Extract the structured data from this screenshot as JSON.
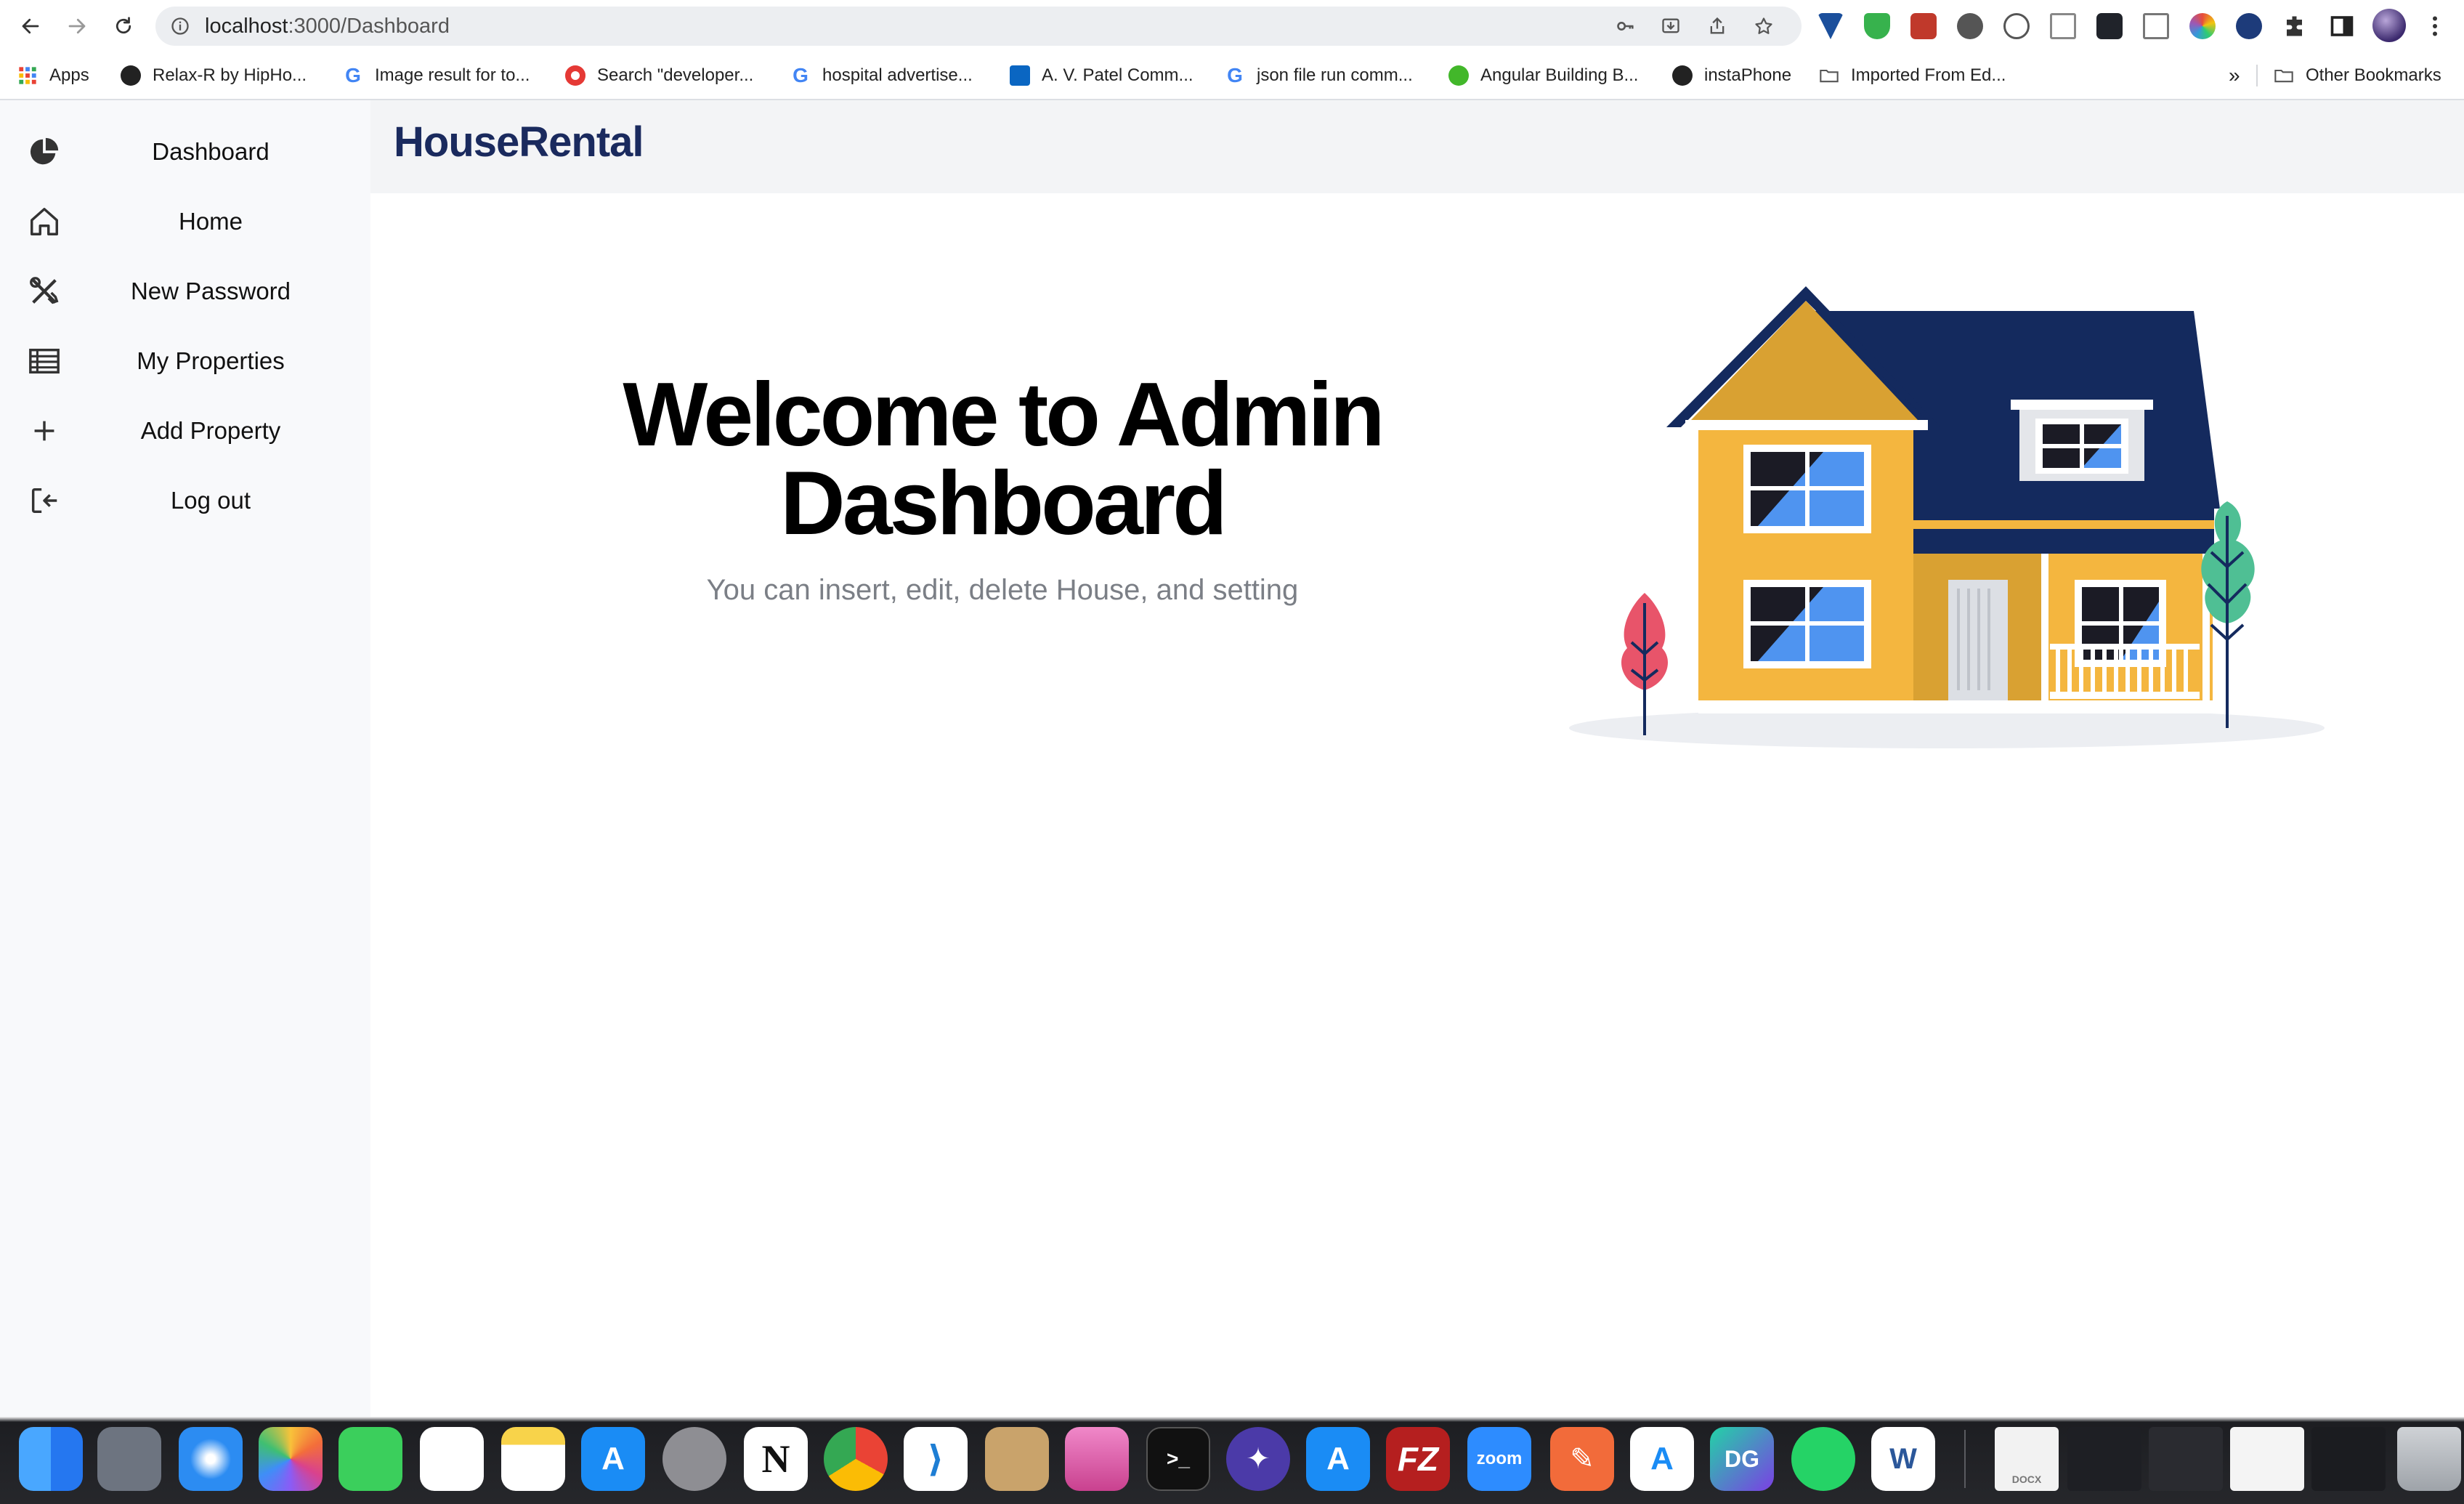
{
  "browser": {
    "url_host": "localhost",
    "url_path": ":3000/Dashboard",
    "bookmarks": [
      {
        "label": "Apps"
      },
      {
        "label": "Relax-R  by HipHo..."
      },
      {
        "label": "Image result for to..."
      },
      {
        "label": "Search \"developer..."
      },
      {
        "label": "hospital advertise..."
      },
      {
        "label": "A. V. Patel Comm..."
      },
      {
        "label": "json file run comm..."
      },
      {
        "label": "Angular Building B..."
      },
      {
        "label": "instaPhone"
      },
      {
        "label": "Imported From Ed..."
      }
    ],
    "overflow": "»",
    "other_bookmarks": "Other Bookmarks"
  },
  "sidebar": {
    "items": [
      {
        "label": "Dashboard",
        "icon": "pie-chart-icon"
      },
      {
        "label": "Home",
        "icon": "home-icon"
      },
      {
        "label": "New Password",
        "icon": "tools-icon"
      },
      {
        "label": "My Properties",
        "icon": "table-icon"
      },
      {
        "label": "Add Property",
        "icon": "plus-icon"
      },
      {
        "label": "Log out",
        "icon": "logout-icon"
      }
    ]
  },
  "header": {
    "brand": "HouseRental"
  },
  "main": {
    "title_line1": "Welcome to Admin",
    "title_line2": "Dashboard",
    "subtitle": "You can insert, edit, delete House, and setting"
  },
  "dock": {
    "zoom_label": "zoom",
    "filezilla_label": "FZ",
    "datagrip_label": "DG",
    "word_label": "W",
    "docx_label": "DOCX"
  },
  "colors": {
    "brand": "#1a2a5e",
    "house_wall": "#f4b63f",
    "house_roof": "#142a5e",
    "window_glass": "#4f94f0",
    "tree_red": "#e8546a",
    "tree_green": "#4fbf94"
  }
}
